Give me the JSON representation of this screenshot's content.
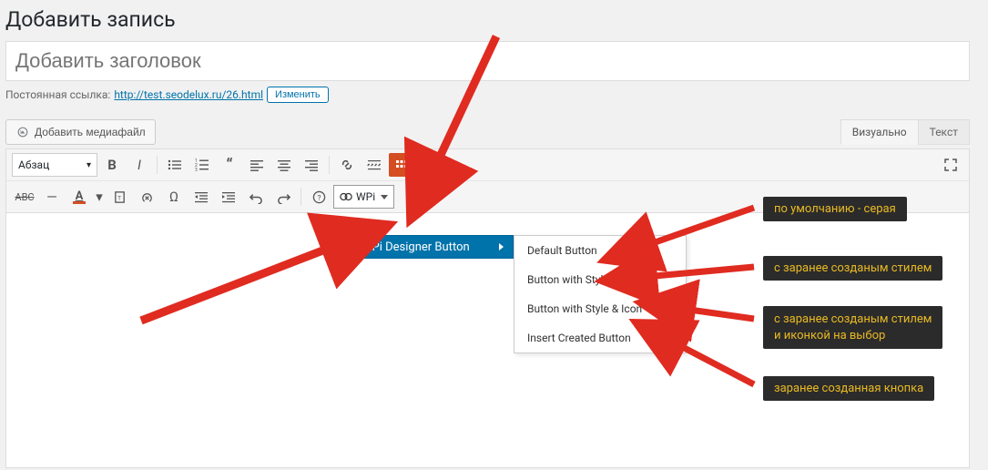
{
  "header": {
    "page_title": "Добавить запись"
  },
  "title_input": {
    "placeholder": "Добавить заголовок",
    "value": ""
  },
  "permalink": {
    "label": "Постоянная ссылка:",
    "url": "http://test.seodelux.ru/26.html",
    "edit_label": "Изменить"
  },
  "media": {
    "add_label": "Добавить медиафайл"
  },
  "tabs": {
    "visual": "Визуально",
    "text": "Текст"
  },
  "toolbar": {
    "format_select": "Абзац",
    "wpi_label": "WPi"
  },
  "dropdown": {
    "parent": "WPi Designer Button",
    "items": [
      "Default Button",
      "Button with Style",
      "Button with Style & Icon",
      "Insert Created Button"
    ]
  },
  "annotations": {
    "a1": "по умолчанию - серая",
    "a2": "с заранее созданым стилем",
    "a3": "с заранее созданым стилем\nи иконкой на выбор",
    "a4": "заранее созданная кнопка"
  }
}
